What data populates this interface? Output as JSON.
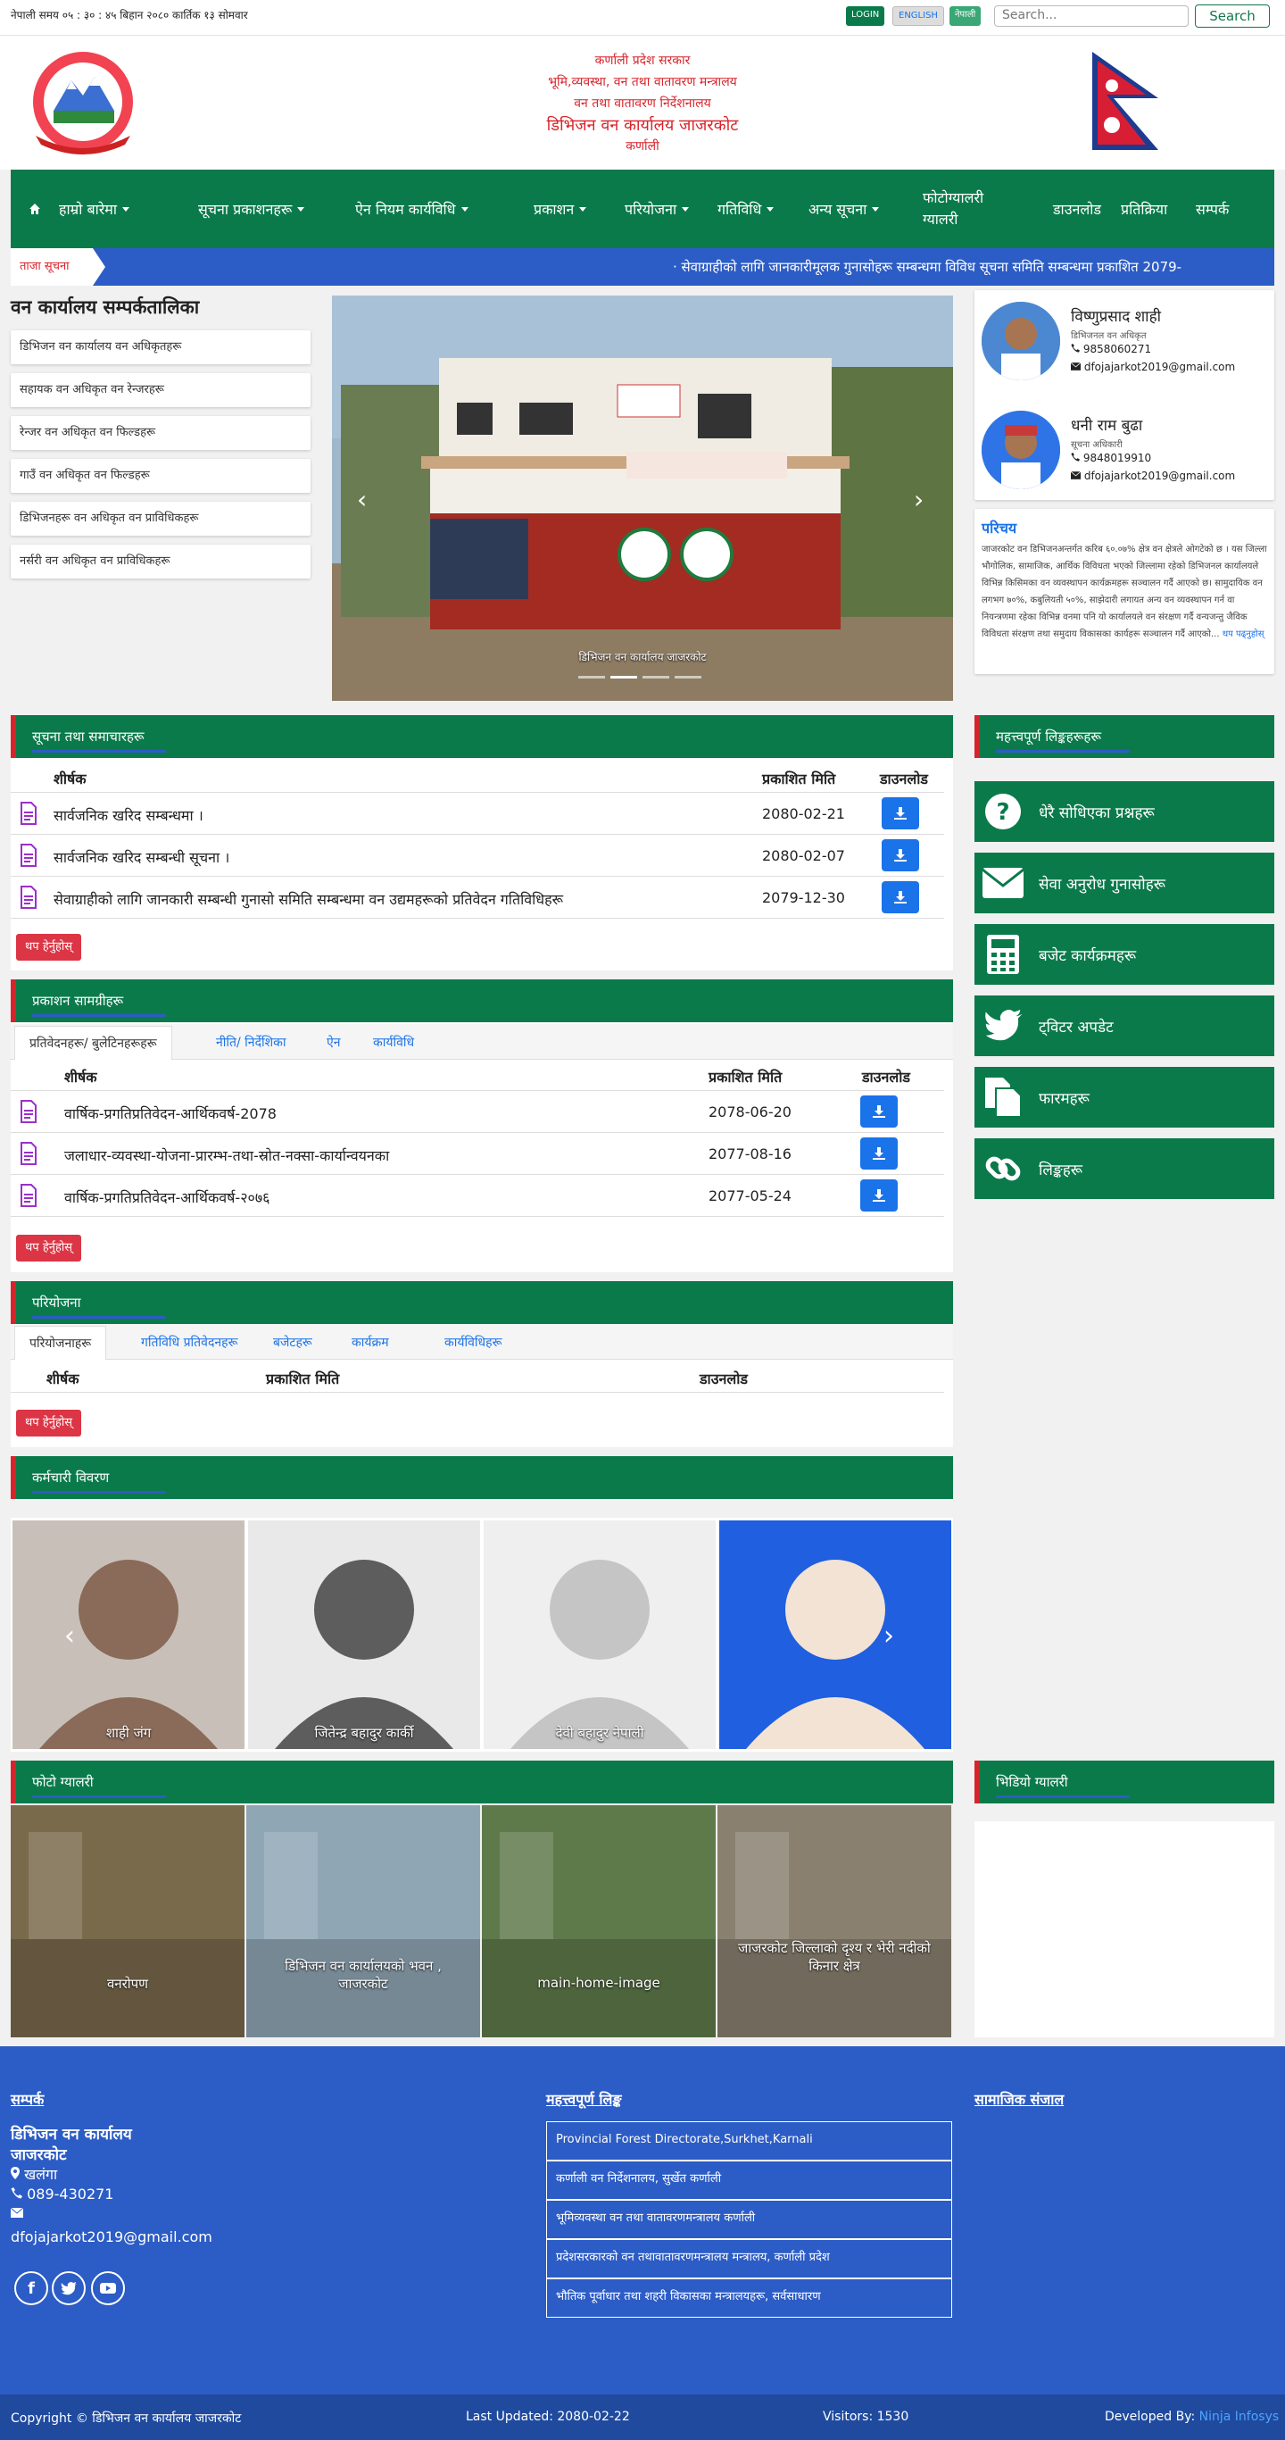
{
  "topbar": {
    "time": "नेपाली समय ०५ : ३० : ४५ बिहान   २०८० कार्तिक १३ सोमवार",
    "login": "LOGIN",
    "english": "ENGLISH",
    "nepali": "नेपाली",
    "search_placeholder": "Search...",
    "search_button": "Search"
  },
  "header": {
    "line1": "कर्णाली प्रदेश सरकार",
    "line2": "भूमि,व्यवस्था, वन तथा वातावरण मन्त्रालय",
    "line3": "वन तथा वातावरण निर्देशनालय",
    "line4": "डिभिजन वन कार्यालय जाजरकोट",
    "line5": "कर्णाली"
  },
  "nav": {
    "home_icon": "home-icon",
    "items": [
      "हाम्रो बारेमा",
      "सूचना प्रकाशनहरू",
      "ऐन नियम कार्यविधि",
      "प्रकाशन",
      "परियोजना",
      "गतिविधि",
      "अन्य सूचना",
      "फोटोग्यालरी ग्यालरी"
    ],
    "right_items": [
      "डाउनलोड",
      "प्रतिक्रिया",
      "सम्पर्क"
    ]
  },
  "ticker": {
    "label": "ताजा सूचना",
    "text": "· सेवाग्राहीको लागि जानकारीमूलक गुनासोहरू सम्बन्धमा विविध सूचना समिति सम्बन्धमा प्रकाशित 2079-"
  },
  "sidebar_left": {
    "title": "वन कार्यालय सम्पर्कतालिका",
    "items": [
      "डिभिजन वन कार्यालय वन अधिकृतहरू",
      "सहायक वन अधिकृत वन रेन्जरहरू",
      "रेन्जर वन अधिकृत वन फिल्डहरू",
      "गाउँ वन अधिकृत वन फिल्डहरू",
      "डिभिजनहरू वन अधिकृत वन प्राविधिकहरू",
      "नर्सरी वन अधिकृत वन प्राविधिकहरू"
    ]
  },
  "slider": {
    "caption": "डिभिजन वन कार्यालय जाजरकोट"
  },
  "staff": [
    {
      "name": "विष्णुप्रसाद शाही",
      "role": "डिभिजनल वन अधिकृत",
      "phone": "9858060271",
      "email": "dfojajarkot2019@gmail.com"
    },
    {
      "name": "धनी राम बुढा",
      "role": "सूचना अधिकारी",
      "phone": "9848019910",
      "email": "dfojajarkot2019@gmail.com"
    }
  ],
  "about": {
    "title": "परिचय",
    "text": "जाजरकोट वन डिभिजनअन्तर्गत करिब ६०.०७% क्षेत्र वन क्षेत्रले ओगटेको छ । यस जिल्ला भौगोलिक, सामाजिक, आर्थिक विविधता भएको जिल्लामा रहेको डिभिजनल कार्यालयले विभिन्न किसिमका वन व्यवस्थापन कार्यक्रमहरू सञ्चालन गर्दै आएको छ। सामुदायिक वन लगभग ७०%, कबुलियती ५०%, साझेदारी लगायत अन्य वन व्यवस्थापन गर्न वा नियन्त्रणमा रहेका विभिन्न वनमा पनि यो कार्यालयले वन संरक्षण गर्दै वन्यजन्तु जैविक विविधता संरक्षण तथा समुदाय विकासका कार्यहरू सञ्चालन गर्दै आएको...",
    "more": "थप पढ्नुहोस्"
  },
  "notices": {
    "title": "सूचना तथा समाचारहरू",
    "headers": [
      "शीर्षक",
      "प्रकाशित मिति",
      "डाउनलोड"
    ],
    "rows": [
      {
        "title": "सार्वजनिक खरिद सम्बन्धमा ।",
        "date": "2080-02-21"
      },
      {
        "title": "सार्वजनिक खरिद सम्बन्धी सूचना ।",
        "date": "2080-02-07"
      },
      {
        "title": "सेवाग्राहीको लागि जानकारी सम्बन्धी गुनासो समिति सम्बन्धमा वन उद्यमहरूको प्रतिवेदन गतिविधिहरू",
        "date": "2079-12-30"
      }
    ],
    "more": "थप हेर्नुहोस्"
  },
  "publications": {
    "title": "प्रकाशन सामग्रीहरू",
    "tabs": [
      "प्रतिवेदनहरू/ बुलेटिनहरूहरू",
      "नीति/ निर्देशिका",
      "ऐन",
      "कार्यविधि"
    ],
    "headers": [
      "शीर्षक",
      "प्रकाशित मिति",
      "डाउनलोड"
    ],
    "rows": [
      {
        "title": "वार्षिक-प्रगतिप्रतिवेदन-आर्थिकवर्ष-2078",
        "date": "2078-06-20"
      },
      {
        "title": "जलाधार-व्यवस्था-योजना-प्रारम्भ-तथा-स्रोत-नक्सा-कार्यान्वयनका",
        "date": "2077-08-16"
      },
      {
        "title": "वार्षिक-प्रगतिप्रतिवेदन-आर्थिकवर्ष-२०७६",
        "date": "2077-05-24"
      }
    ],
    "more": "थप हेर्नुहोस्"
  },
  "projects": {
    "title": "परियोजना",
    "tabs": [
      "परियोजनाहरू",
      "गतिविधि प्रतिवेदनहरू",
      "बजेटहरू",
      "कार्यक्रम",
      "कार्यविधिहरू"
    ],
    "headers": [
      "शीर्षक",
      "प्रकाशित मिति",
      "डाउनलोड"
    ],
    "more": "थप हेर्नुहोस्"
  },
  "staff_gallery": {
    "title": "कर्मचारी विवरण",
    "items": [
      "शाही जंग",
      "जितेन्द्र बहादुर कार्की",
      "देवी बहादुर नेपाली",
      ""
    ]
  },
  "photo_gallery": {
    "title": "फोटो ग्यालरी",
    "items": [
      "वनरोपण",
      "डिभिजन वन कार्यालयको भवन , जाजरकोट",
      "main-home-image",
      "जाजरकोट जिल्लाको दृश्य र भेरी नदीको किनार क्षेत्र"
    ]
  },
  "right_panels": {
    "quick_title": "महत्त्वपूर्ण लिङ्कहरूहरू",
    "quick_links": [
      {
        "icon": "question-icon",
        "label": "धेरै सोधिएका प्रश्नहरू"
      },
      {
        "icon": "envelope-icon",
        "label": "सेवा अनुरोध गुनासोहरू"
      },
      {
        "icon": "calculator-icon",
        "label": "बजेट कार्यक्रमहरू"
      },
      {
        "icon": "twitter-icon",
        "label": "ट्विटर अपडेट"
      },
      {
        "icon": "document-icon",
        "label": "फारमहरू"
      },
      {
        "icon": "link-icon",
        "label": "लिङ्कहरू"
      }
    ],
    "video_title": "भिडियो ग्यालरी"
  },
  "footer": {
    "contact_title": "सम्पर्क",
    "office": "डिभिजन वन कार्यालय जाजरकोट",
    "location": "खलंगा",
    "phone": "089-430271",
    "email": "dfojajarkot2019@gmail.com",
    "links_title": "महत्त्वपूर्ण लिङ्क",
    "links": [
      "Provincial Forest Directorate,Surkhet,Karnali",
      "कर्णाली वन निर्देशनालय, सुर्खेत कर्णाली",
      "भूमिव्यवस्था वन तथा वातावरणमन्त्रालय कर्णाली",
      "प्रदेशसरकारको वन तथावातावरणमन्त्रालय मन्त्रालय, कर्णाली प्रदेश",
      "भौतिक पूर्वाधार तथा शहरी विकासका मन्त्रालयहरू, सर्वसाधारण"
    ],
    "social_title": "सामाजिक संजाल",
    "copyright": "Copyright © डिभिजन वन कार्यालय जाजरकोट",
    "updated": "Last Updated: 2080-02-22",
    "visitors": "Visitors: 1530",
    "developed": "Developed By:",
    "developer": "Ninja Infosys"
  }
}
